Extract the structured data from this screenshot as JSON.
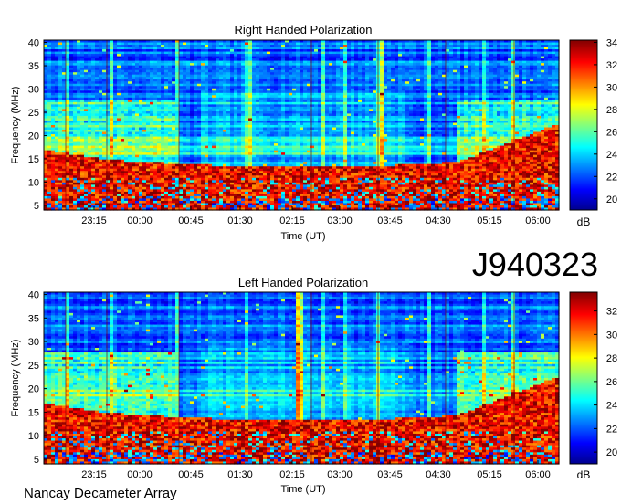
{
  "observation_id": "J940323",
  "footer": "Nancay Decameter Array",
  "colors": {
    "jet_stops": [
      "#00008f",
      "#0000ff",
      "#00ffff",
      "#ffff00",
      "#ff0000",
      "#800000"
    ]
  },
  "chart_data": [
    {
      "type": "heatmap",
      "title": "Right Handed Polarization",
      "xlabel": "Time (UT)",
      "ylabel": "Frequency (MHz)",
      "x_ticks": [
        "23:15",
        "00:00",
        "00:45",
        "01:30",
        "02:15",
        "03:00",
        "03:45",
        "04:30",
        "05:15",
        "06:00"
      ],
      "y_ticks": [
        5,
        10,
        15,
        20,
        25,
        30,
        35,
        40
      ],
      "ylim": [
        4,
        40.5
      ],
      "colorbar": {
        "label": "dB",
        "ticks": [
          20,
          22,
          24,
          26,
          28,
          30,
          32,
          34
        ],
        "range": [
          19,
          34.2
        ]
      },
      "colormap": "jet"
    },
    {
      "type": "heatmap",
      "title": "Left Handed Polarization",
      "xlabel": "Time (UT)",
      "ylabel": "Frequency (MHz)",
      "x_ticks": [
        "23:15",
        "00:00",
        "00:45",
        "01:30",
        "02:15",
        "03:00",
        "03:45",
        "04:30",
        "05:15",
        "06:00"
      ],
      "y_ticks": [
        5,
        10,
        15,
        20,
        25,
        30,
        35,
        40
      ],
      "ylim": [
        4,
        40.5
      ],
      "colorbar": {
        "label": "dB",
        "ticks": [
          20,
          22,
          24,
          26,
          28,
          30,
          32
        ],
        "range": [
          19,
          33.6
        ]
      },
      "colormap": "jet"
    }
  ]
}
